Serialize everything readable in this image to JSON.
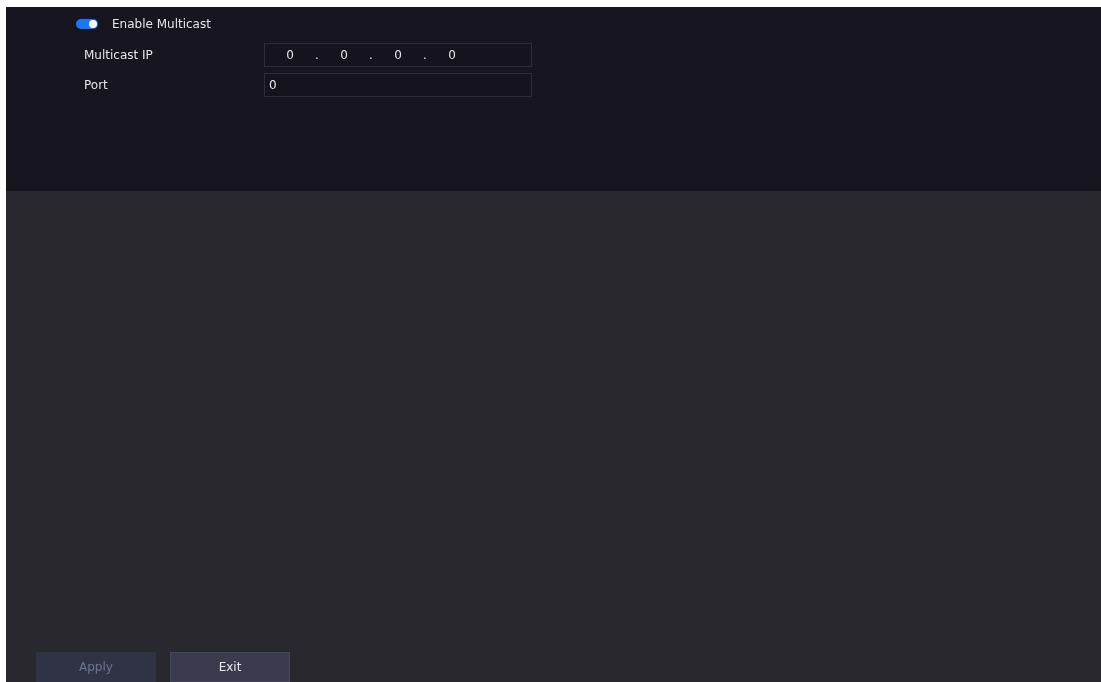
{
  "multicast": {
    "enabled": true,
    "label": "Enable Multicast"
  },
  "fields": [
    {
      "kind": "ip",
      "label": "Multicast IP",
      "octets": [
        "0",
        "0",
        "0",
        "0"
      ],
      "separator": "."
    },
    {
      "kind": "text",
      "label": "Port",
      "value": "0"
    }
  ],
  "buttons": [
    {
      "label": "Apply",
      "disabled": true
    },
    {
      "label": "Exit",
      "disabled": false
    }
  ]
}
